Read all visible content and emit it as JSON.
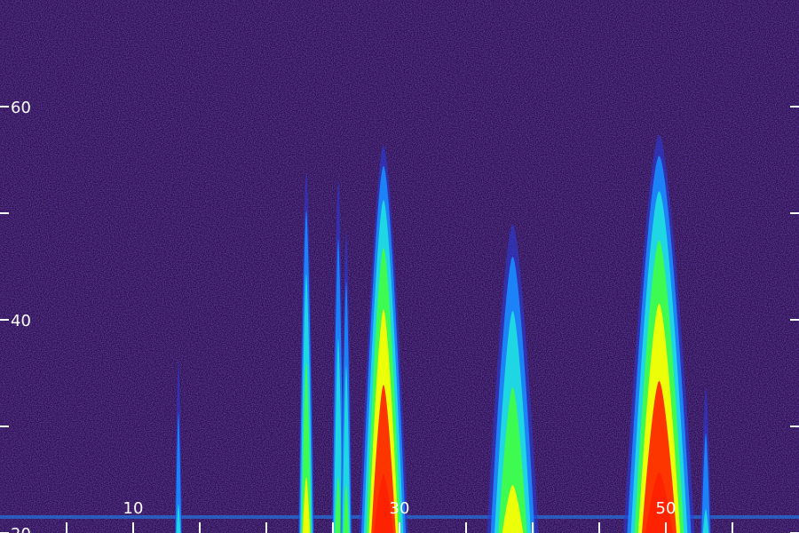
{
  "chart_data": {
    "type": "heatmap",
    "title": "",
    "xlabel": "",
    "ylabel": "",
    "xlim": [
      0,
      60
    ],
    "ylim": [
      20,
      70
    ],
    "x_ticks_major": [
      10,
      30,
      50
    ],
    "x_ticks_minor": [
      5,
      15,
      20,
      25,
      35,
      40,
      45,
      55
    ],
    "y_ticks_labeled": [
      20,
      40,
      60
    ],
    "y_ticks_minor": [
      30,
      50
    ],
    "x_tick_labels": [
      "10",
      "30",
      "50"
    ],
    "y_tick_labels": [
      "20",
      "40",
      "60"
    ],
    "grid": false,
    "legend": "none",
    "colormap": [
      "#2a0b4a",
      "#3a1a8a",
      "#2a3cd8",
      "#1a8cff",
      "#20e0e0",
      "#40ff40",
      "#ffff00",
      "#ff2000"
    ],
    "background_color": "#2a0b4a",
    "noise_band_y": 21.5,
    "bursts": [
      {
        "x": 23.0,
        "width": 0.35,
        "top": 55,
        "peak": 0.75
      },
      {
        "x": 25.4,
        "width": 0.3,
        "top": 55,
        "peak": 0.55
      },
      {
        "x": 26.0,
        "width": 0.25,
        "top": 50,
        "peak": 0.6
      },
      {
        "x": 28.8,
        "width": 1.1,
        "top": 57,
        "peak": 1.0
      },
      {
        "x": 38.5,
        "width": 1.2,
        "top": 50,
        "peak": 0.7
      },
      {
        "x": 49.5,
        "width": 1.6,
        "top": 58,
        "peak": 0.95
      },
      {
        "x": 53.0,
        "width": 0.25,
        "top": 35,
        "peak": 0.45
      },
      {
        "x": 13.4,
        "width": 0.15,
        "top": 38,
        "peak": 0.45
      }
    ]
  }
}
